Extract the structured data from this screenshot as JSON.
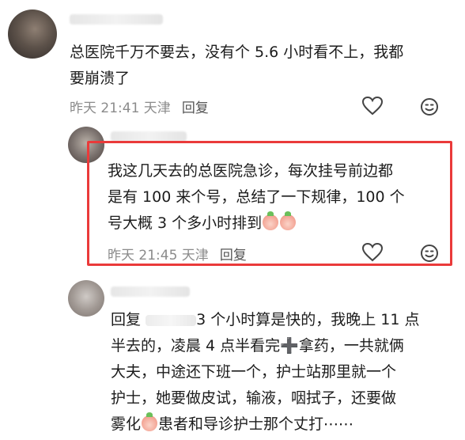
{
  "comments": [
    {
      "text_line1": "总医院千万不要去，没有个 5.6 小时看不上，我都",
      "text_line2": "要崩溃了",
      "time": "昨天 21:41 天津",
      "reply_label": "回复"
    },
    {
      "text_line1": "我这几天去的总医院急诊，每次挂号前边都",
      "text_line2": "是有 100 来个号，总结了一下规律，100 个",
      "text_line3": "号大概 3 个多小时排到",
      "time": "昨天 21:45 天津",
      "reply_label": "回复"
    },
    {
      "line1_prefix": "回复",
      "line1_suffix": "3 个小时算是快的，我晚上 11 点",
      "line2_a": "半去的，凌晨 4 点半看完",
      "line2_plus": "➕",
      "line2_b": "拿药，一共就俩",
      "line3": "大夫，中途还下班一个，护士站那里就一个",
      "line4": "护士，她要做皮试，输液，咽拭子，还要做",
      "line5_a": "雾化",
      "line5_b": "患者和导诊护士那个丈打⋯⋯"
    }
  ],
  "icons": {
    "like": "heart-outline-icon",
    "emoji": "smiley-face-icon"
  },
  "colors": {
    "highlight_border": "#ea3a3a",
    "meta_text": "#8b8b8b",
    "body_text": "#1c1c1c"
  }
}
